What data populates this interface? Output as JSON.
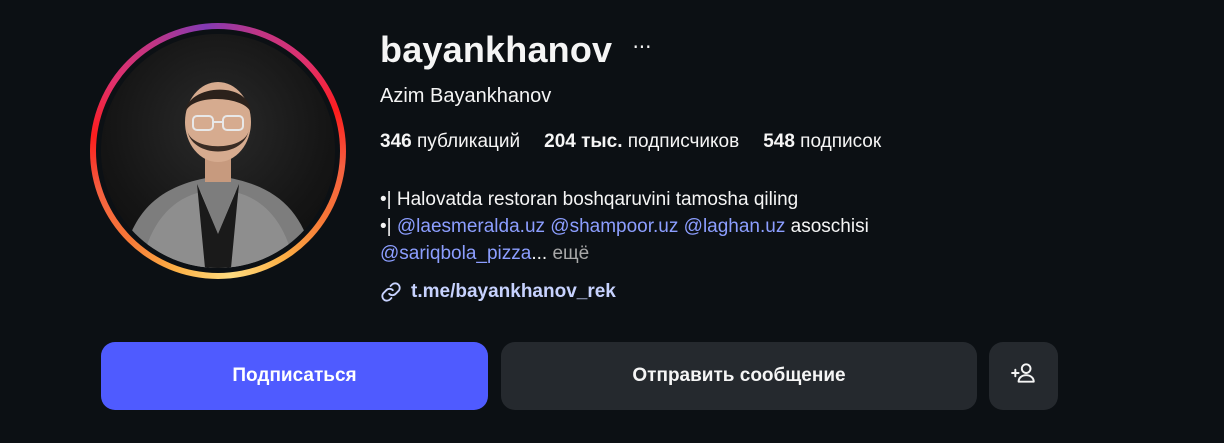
{
  "profile": {
    "username": "bayankhanov",
    "more_icon": "···",
    "full_name": "Azim Bayankhanov"
  },
  "stats": {
    "posts_count": "346",
    "posts_label": "публикаций",
    "followers_count": "204 тыс.",
    "followers_label": "подписчиков",
    "following_count": "548",
    "following_label": "подписок"
  },
  "bio": {
    "line1": "•| Halovatda restoran boshqaruvini tamosha qiling",
    "line2_prefix": "•| ",
    "mention1": "@laesmeralda.uz",
    "mention2": "@shampoor.uz",
    "mention3": "@laghan.uz",
    "line2_suffix": "asoschisi",
    "mention4": "@sariqbola_pizza",
    "ellipsis": "...",
    "more_label": "ещё"
  },
  "link": {
    "text": "t.me/bayankhanov_rek",
    "icon": "link-icon"
  },
  "actions": {
    "follow_label": "Подписаться",
    "message_label": "Отправить сообщение",
    "suggest_icon": "add-person-icon"
  },
  "colors": {
    "background": "#0c1014",
    "accent_button": "#4f5bff",
    "secondary_button": "#25292e",
    "mention": "#8c9eff",
    "link": "#c7d2fe"
  }
}
